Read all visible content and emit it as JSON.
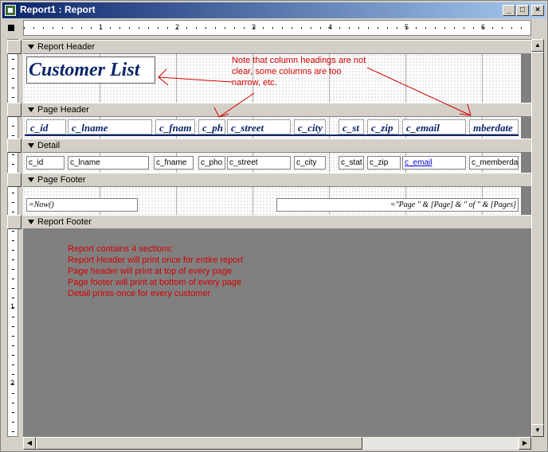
{
  "window": {
    "title": "Report1 : Report",
    "min_label": "_",
    "max_label": "□",
    "close_label": "×"
  },
  "ruler": {
    "marks": [
      "1",
      "2",
      "3",
      "4",
      "5",
      "6"
    ],
    "v_marks": [
      "1",
      "2"
    ]
  },
  "sections": {
    "report_header": "Report Header",
    "page_header": "Page Header",
    "detail": "Detail",
    "page_footer": "Page Footer",
    "report_footer": "Report Footer"
  },
  "report_header": {
    "title": "Customer List"
  },
  "page_header": {
    "columns": [
      "c_id",
      "c_lname",
      "c_fnam",
      "c_ph",
      "c_street",
      "c_city",
      "c_st",
      "c_zip",
      "c_email",
      "mberdate"
    ]
  },
  "detail": {
    "fields": [
      "c_id",
      "c_lname",
      "c_fname",
      "c_pho",
      "c_street",
      "c_city",
      "c_stat",
      "c_zip",
      "c_email",
      "c_memberda"
    ]
  },
  "page_footer": {
    "left_expr": "=Now()",
    "right_expr": "=\"Page \" & [Page] & \" of \" & [Pages]"
  },
  "notes": {
    "column_note": "Note that column headings are not clear, some columns are too narrow, etc.",
    "sections_note": [
      "Report contains 4 sections:",
      "Report Header will print once for entire report",
      "Page header will print at top of every page",
      "Page footer will print at bottom of every page",
      "Detail prints once for every customer"
    ]
  },
  "colors": {
    "note": "#d40000",
    "heading": "#0a246a",
    "titlebar": "#0a246a",
    "link": "#0000cc"
  },
  "icons": {
    "window_icon": "report-icon",
    "section_arrow": "triangle-down-icon"
  }
}
